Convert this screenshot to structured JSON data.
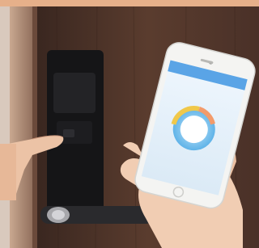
{
  "scene": {
    "description_elements": [
      "door",
      "smart-lock",
      "hand",
      "smartphone",
      "phone-app"
    ],
    "colors": {
      "door_wood": "#4a3228",
      "lock_body": "#1b1b1d",
      "lever": "#2a2a2d",
      "phone_body": "#f4f4f2",
      "app_header": "#5aa4e6",
      "dial_blue": "#79c4f0",
      "dial_gold": "#f0c84a",
      "skin": "#f1cdb3"
    }
  },
  "phone_app": {
    "header_title": "",
    "dial_label": ""
  }
}
